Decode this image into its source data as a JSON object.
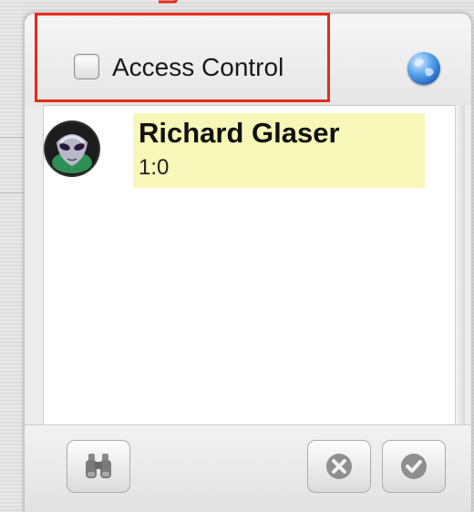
{
  "access_control": {
    "label": "Access Control",
    "checked": false
  },
  "users": [
    {
      "name": "Richard Glaser",
      "subtitle": "1:0",
      "avatar": "alien-avatar"
    }
  ],
  "icons": {
    "globe": "globe-icon",
    "search": "binoculars-icon",
    "remove": "remove-icon",
    "accept": "checkmark-icon"
  },
  "colors": {
    "highlight_box": "#e52b1a",
    "selected_row": "#f6f7b8"
  }
}
